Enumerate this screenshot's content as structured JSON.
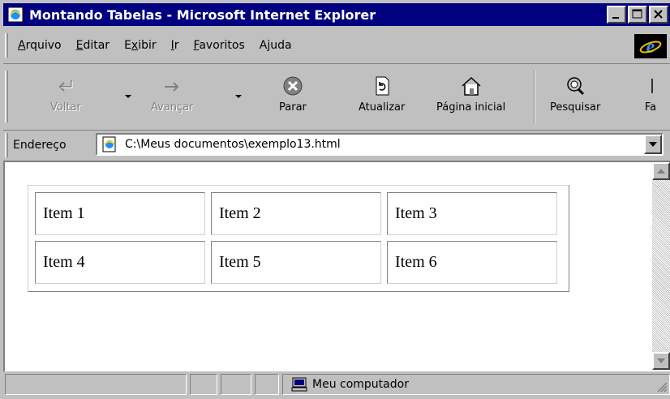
{
  "window": {
    "title": "Montando Tabelas - Microsoft Internet Explorer"
  },
  "menu": {
    "items": [
      {
        "label": "Arquivo",
        "accel": "A"
      },
      {
        "label": "Editar",
        "accel": "E"
      },
      {
        "label": "Exibir",
        "accel": "x"
      },
      {
        "label": "Ir",
        "accel": "I"
      },
      {
        "label": "Favoritos",
        "accel": "F"
      },
      {
        "label": "Ajuda",
        "accel": "j"
      }
    ]
  },
  "toolbar": {
    "back_label": "Voltar",
    "forward_label": "Avançar",
    "stop_label": "Parar",
    "refresh_label": "Atualizar",
    "home_label": "Página inicial",
    "search_label": "Pesquisar",
    "favorites_label": "Fa"
  },
  "address": {
    "label": "Endereço",
    "value": "C:\\Meus documentos\\exemplo13.html"
  },
  "content": {
    "table": [
      [
        "Item 1",
        "Item 2",
        "Item 3"
      ],
      [
        "Item 4",
        "Item 5",
        "Item 6"
      ]
    ]
  },
  "status": {
    "zone_text": "Meu computador"
  },
  "colors": {
    "titlebar": "#000080",
    "chrome": "#c0c0c0"
  }
}
